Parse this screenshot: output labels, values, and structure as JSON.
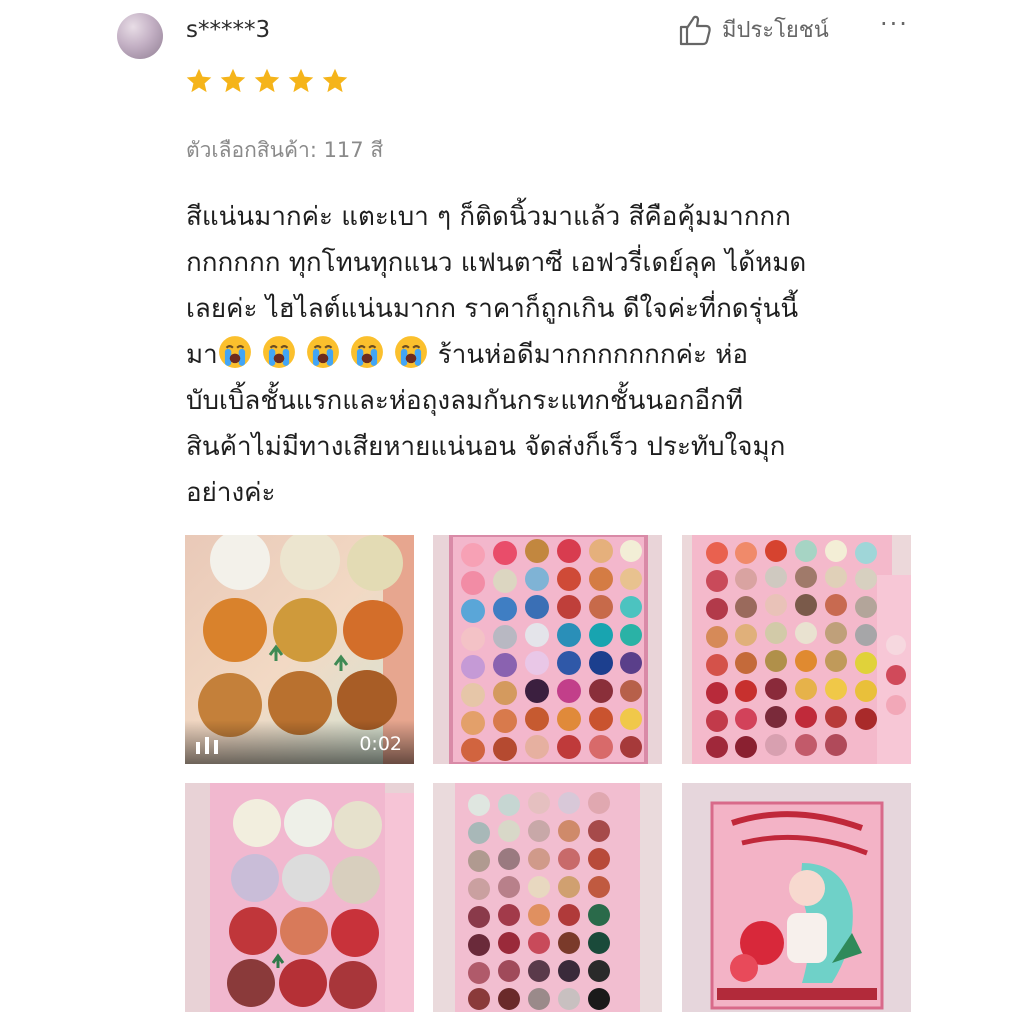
{
  "reviewer": {
    "name": "s*****3",
    "avatar_icon": "avatar-image"
  },
  "actions": {
    "helpful_label": "มีประโยชน์",
    "helpful_icon": "thumbs-up-icon",
    "more_label": "···",
    "more_icon": "more-options-icon"
  },
  "rating": {
    "stars": 5,
    "max": 5,
    "color": "#f5b41a"
  },
  "variant": {
    "label": "ตัวเลือกสินค้า: 117 สี"
  },
  "review": {
    "lines": [
      "สีแน่นมากค่ะ แตะเบา ๆ ก็ติดนิ้วมาแล้ว สีคือคุ้มมากกก",
      "กกกกกก ทุกโทนทุกแนว แฟนตาซี เอฟวรี่เดย์ลุค ได้หมด",
      "เลยค่ะ ไฮไลต์แน่นมากก ราคาก็ถูกเกิน ดีใจค่ะที่กดรุ่นนี้",
      "มา",
      "ร้านห่อดีมากกกกกกกค่ะ ห่อ",
      "บับเบิ้ลชั้นแรกและห่อถุงลมกันกระแทกชั้นนอกอีกที",
      "สินค้าไม่มีทางเสียหายแน่นอน จัดส่งก็เร็ว ประทับใจมุก",
      "อย่างค่ะ"
    ],
    "emoji_icon": "loudly-crying-face-icon",
    "emoji_count": 5
  },
  "media": {
    "video": {
      "duration": "0:02",
      "pause_icon": "pause-icon"
    },
    "items": [
      {
        "type": "video"
      },
      {
        "type": "image"
      },
      {
        "type": "image"
      },
      {
        "type": "image"
      },
      {
        "type": "image"
      },
      {
        "type": "image"
      }
    ]
  }
}
